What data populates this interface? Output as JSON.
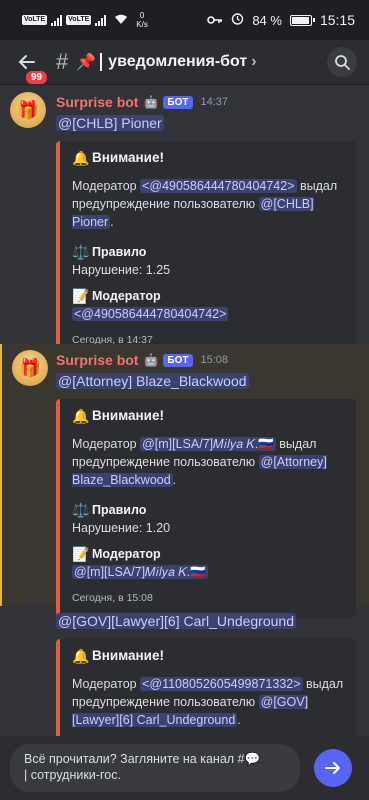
{
  "status": {
    "sim1": "VoLTE",
    "sim2": "VoLTE",
    "speed_value": "0",
    "speed_unit": "K/s",
    "battery": "84 %",
    "battery_level": 0.84,
    "time": "15:15"
  },
  "header": {
    "unread_badge": "99",
    "channel_name": "уведомления-бот"
  },
  "messages": [
    {
      "author": "Surprise bot",
      "bot_tag": "БОТ",
      "time": "14:37",
      "mention": "@[CHLB] Pioner",
      "embed": {
        "title": "Внимание!",
        "desc_prefix": "Модератор",
        "moderator_mention": "<@490586444780404742>",
        "desc_middle": "выдал предупреждение пользователю",
        "user_mention": "@[CHLB] Pioner",
        "rule_label": "Правило",
        "violation": "Нарушение: 1.25",
        "moderator_label": "Модератор",
        "moderator_value": "<@490586444780404742>",
        "footer": "Сегодня, в 14:37"
      }
    },
    {
      "author": "Surprise bot",
      "bot_tag": "БОТ",
      "time": "15:08",
      "mention": "@[Attorney] Blaze_Blackwood",
      "embed": {
        "title": "Внимание!",
        "desc_prefix": "Модератор",
        "moderator_mention": "@[m][LSA/7]𝑀𝑖𝑙𝑦𝑎 𝐾.🇷🇺",
        "desc_middle": "выдал предупреждение пользователю",
        "user_mention": "@[Attorney] Blaze_Blackwood",
        "rule_label": "Правило",
        "violation": "Нарушение: 1.20",
        "moderator_label": "Модератор",
        "moderator_value": "@[m][LSA/7]𝑀𝑖𝑙𝑦𝑎 𝐾.🇷🇺",
        "footer": "Сегодня, в 15:08"
      }
    },
    {
      "mention": "@[GOV][Lawyer][6] Carl_Undeground",
      "embed": {
        "title": "Внимание!",
        "desc_prefix": "Модератор",
        "moderator_mention": "<@1108052605499871332>",
        "desc_middle": "выдал предупреждение пользователю",
        "user_mention": "@[GOV][Lawyer][6] Carl_Undeground"
      }
    }
  ],
  "composer": {
    "text_line1": "Всё прочитали? Загляните на канал #💬",
    "text_line2": "| сотрудники-гос."
  },
  "icons": {
    "bell": "🔔",
    "scales": "⚖️",
    "memo": "📝",
    "gift": "🎁",
    "pin": "📌",
    "robot": "🤖"
  }
}
